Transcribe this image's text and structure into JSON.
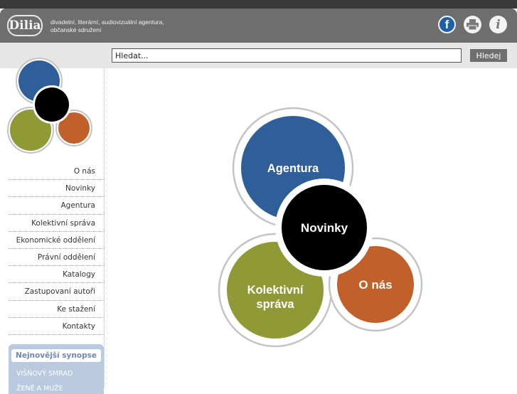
{
  "header": {
    "logo_text": "Dilia",
    "tagline_line1": "divadelní, literární, audiovizuální agentura,",
    "tagline_line2": "občanské sdružení",
    "icons": [
      "facebook-icon",
      "print-icon",
      "info-icon"
    ]
  },
  "search": {
    "placeholder": "Hledat...",
    "button_label": "Hledej"
  },
  "sidebar": {
    "menu": [
      {
        "label": "O nás"
      },
      {
        "label": "Novinky"
      },
      {
        "label": "Agentura"
      },
      {
        "label": "Kolektivní správa"
      },
      {
        "label": "Ekonomické oddělení"
      },
      {
        "label": "Právní oddělení"
      },
      {
        "label": "Katalogy"
      },
      {
        "label": "Zastupovaní autoři"
      },
      {
        "label": "Ke stažení"
      },
      {
        "label": "Kontakty"
      }
    ],
    "synopse": {
      "title": "Nejnovější synopse",
      "items": [
        "VIŠŇOVÝ SMRAD",
        "ŽENĚ A MUŽE"
      ]
    }
  },
  "main": {
    "circles": {
      "agentura": "Agentura",
      "novinky": "Novinky",
      "kolektivni_line1": "Kolektivní",
      "kolektivni_line2": "správa",
      "onas": "O nás"
    }
  },
  "colors": {
    "blue": "#2f5f98",
    "black": "#000000",
    "olive": "#8f9a36",
    "orange": "#c0602a",
    "header_gray": "#6e6e6e"
  }
}
